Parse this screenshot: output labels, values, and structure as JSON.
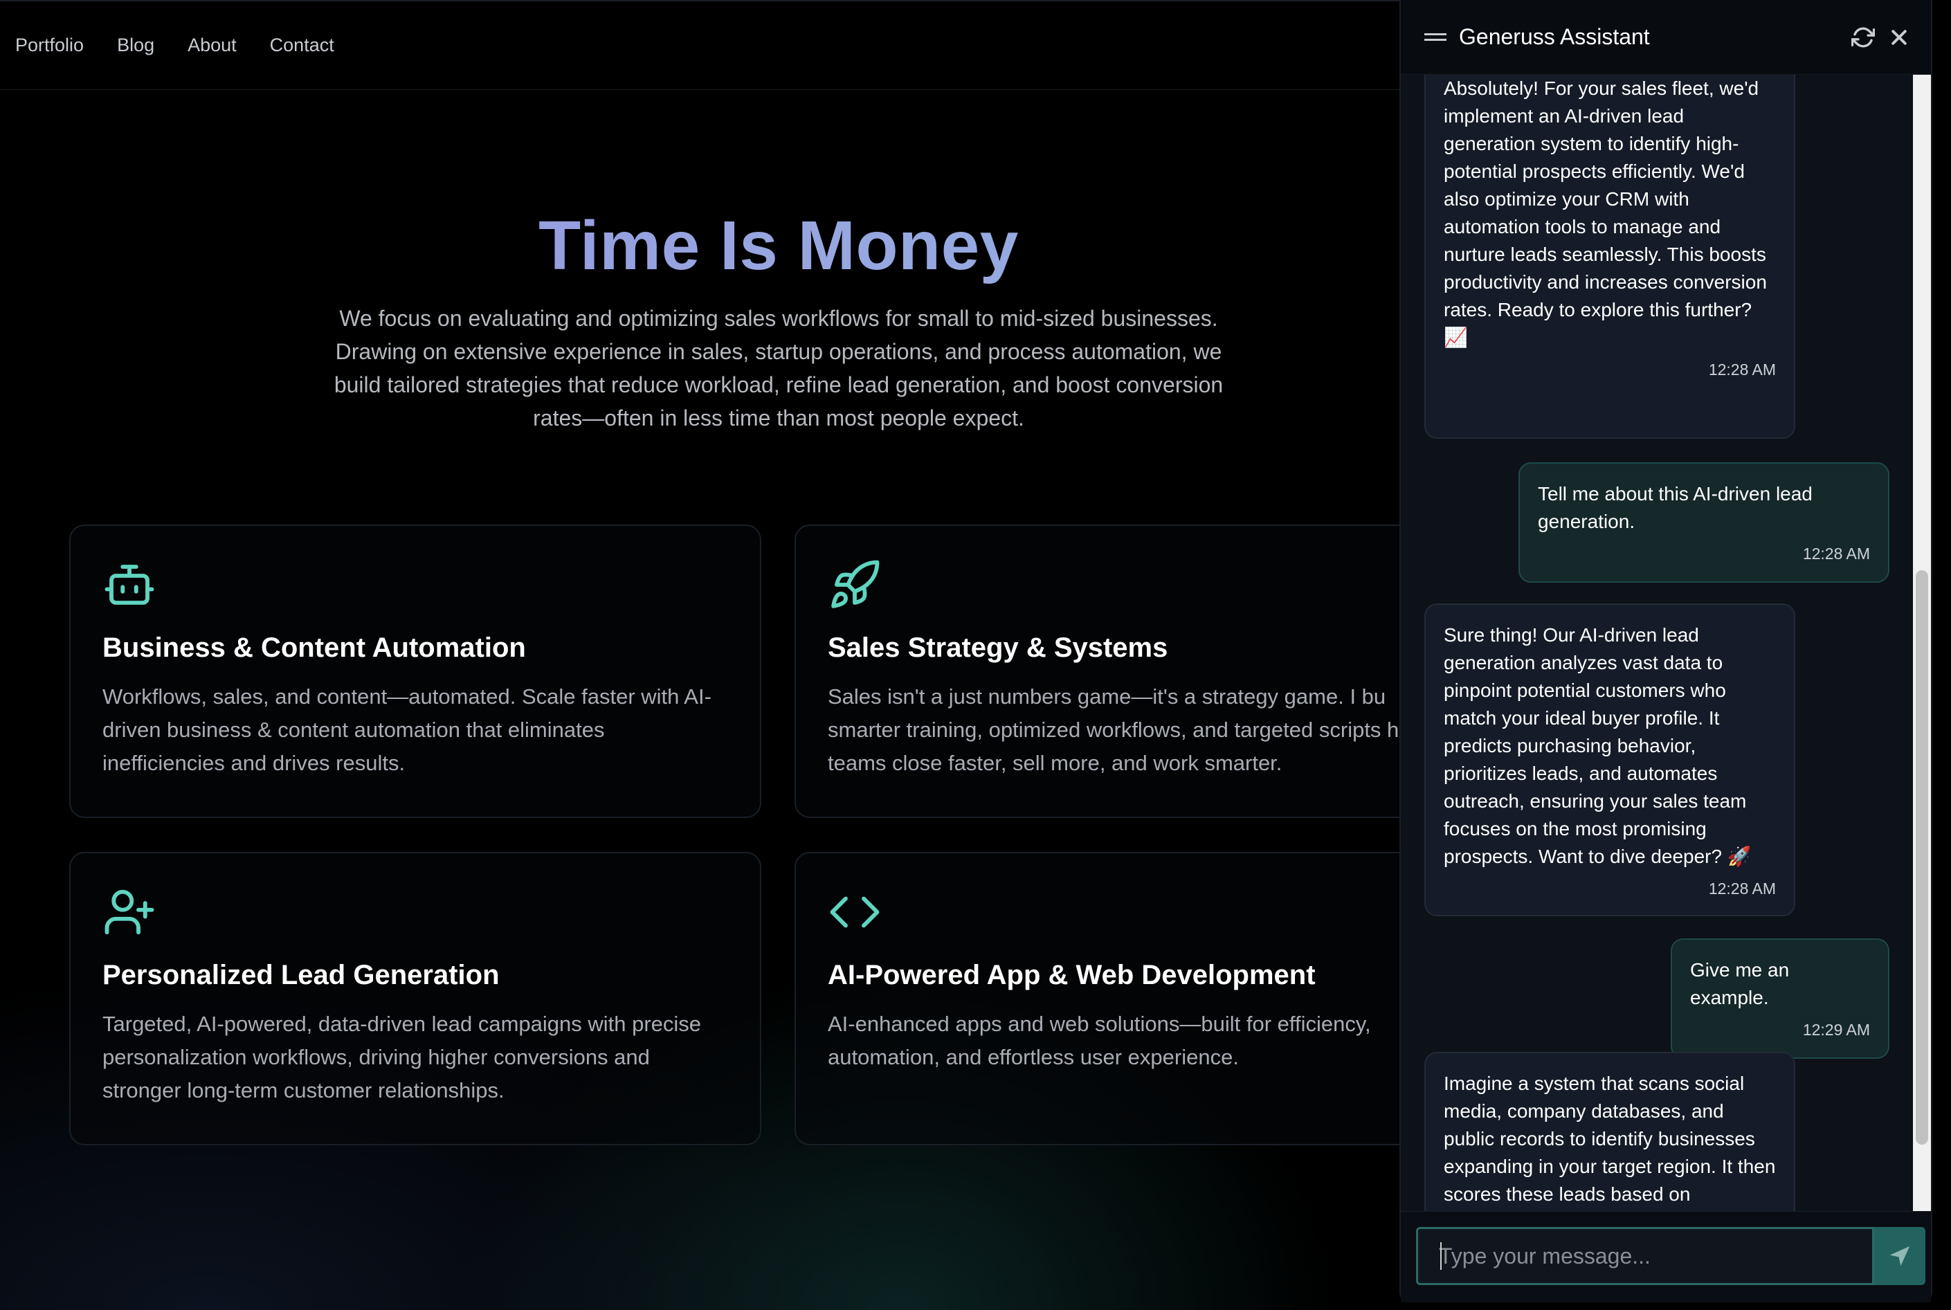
{
  "nav": {
    "items": [
      {
        "label": "Portfolio"
      },
      {
        "label": "Blog"
      },
      {
        "label": "About"
      },
      {
        "label": "Contact"
      }
    ]
  },
  "hero": {
    "title": "Time Is Money",
    "description": "We focus on evaluating and optimizing sales workflows for small to mid-sized businesses. Drawing on extensive experience in sales, startup operations, and process automation, we build tailored strategies that reduce workload, refine lead generation, and boost conversion rates—often in less time than most people expect."
  },
  "cards": [
    {
      "icon": "robot-icon",
      "title": "Business & Content Automation",
      "text": "Workflows, sales, and content—automated. Scale faster with AI-driven business & content automation that eliminates inefficiencies and drives results."
    },
    {
      "icon": "rocket-icon",
      "title": "Sales Strategy & Systems",
      "text": "Sales isn't a just numbers game—it's a strategy game. I bu smarter training, optimized workflows, and targeted scripts help teams close faster, sell more, and work smarter."
    },
    {
      "icon": "user-plus-icon",
      "title": "Personalized Lead Generation",
      "text": "Targeted, AI-powered, data-driven lead campaigns with precise personalization workflows, driving higher conversions and stronger long-term customer relationships."
    },
    {
      "icon": "code-icon",
      "title": "AI-Powered App & Web Development",
      "text": "AI-enhanced apps and web solutions—built for efficiency, automation, and effortless user experience."
    }
  ],
  "chat": {
    "title": "Generuss Assistant",
    "accent": "#2a6a66",
    "messages": [
      {
        "role": "assistant",
        "text": "Absolutely! For your sales fleet, we'd implement an AI-driven lead generation system to identify high-potential prospects efficiently. We'd also optimize your CRM with automation tools to manage and nurture leads seamlessly. This boosts productivity and increases conversion rates. Ready to explore this further? 📈",
        "time": "12:28 AM"
      },
      {
        "role": "user",
        "text": "Tell me about this AI-driven lead generation.",
        "time": "12:28 AM"
      },
      {
        "role": "assistant",
        "text": "Sure thing! Our AI-driven lead generation analyzes vast data to pinpoint potential customers who match your ideal buyer profile. It predicts purchasing behavior, prioritizes leads, and automates outreach, ensuring your sales team focuses on the most promising prospects. Want to dive deeper? 🚀",
        "time": "12:28 AM"
      },
      {
        "role": "user",
        "text": "Give me an example.",
        "time": "12:29 AM"
      },
      {
        "role": "assistant",
        "text": "Imagine a system that scans social media, company databases, and public records to identify businesses expanding in your target region. It then scores these leads based on engagement and relevance, automatically queuing them up for your sales team. Curious to see it in action?",
        "time": ""
      }
    ],
    "input": {
      "placeholder": "Type your message...",
      "value": ""
    }
  }
}
